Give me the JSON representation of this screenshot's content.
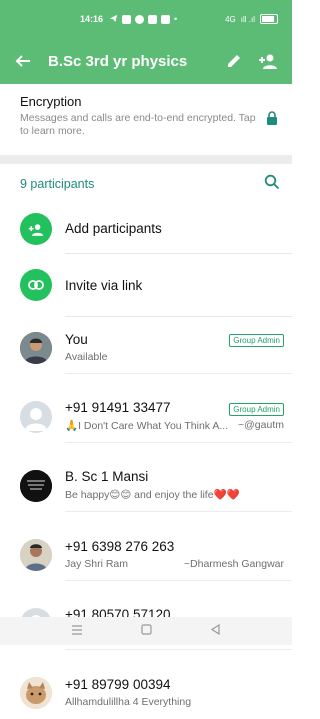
{
  "status_bar": {
    "time": "14:16",
    "dot": "•",
    "network": "4G",
    "signal": "ıll .ıl"
  },
  "header": {
    "title": "B.Sc 3rd yr physics"
  },
  "encryption": {
    "title": "Encryption",
    "description": "Messages and calls are end-to-end encrypted. Tap to learn more."
  },
  "participants": {
    "count_label": "9 participants",
    "add_label": "Add participants",
    "invite_label": "Invite via link",
    "members": [
      {
        "name": "You",
        "status": "Available",
        "admin_badge": "Group Admin"
      },
      {
        "name": "+91 91491 33477",
        "status": "🙏I Don't Care What You Think A...",
        "alias": "~@gautm",
        "admin_badge": "Group Admin"
      },
      {
        "name": "B. Sc 1 Mansi",
        "status": "Be happy😊😊 and enjoy the life❤️❤️"
      },
      {
        "name": "+91 6398 276 263",
        "status": "Jay Shri Ram",
        "alias": "~Dharmesh Gangwar"
      },
      {
        "name": "+91 80570 57120",
        "status": "🙋🙋🙋"
      },
      {
        "name": "+91 89799 00394",
        "status": "Allhamdulillha 4 Everything"
      }
    ]
  },
  "colors": {
    "header_green": "#5cbb75",
    "accent_teal": "#1f8c7a",
    "action_green": "#22c15e"
  }
}
